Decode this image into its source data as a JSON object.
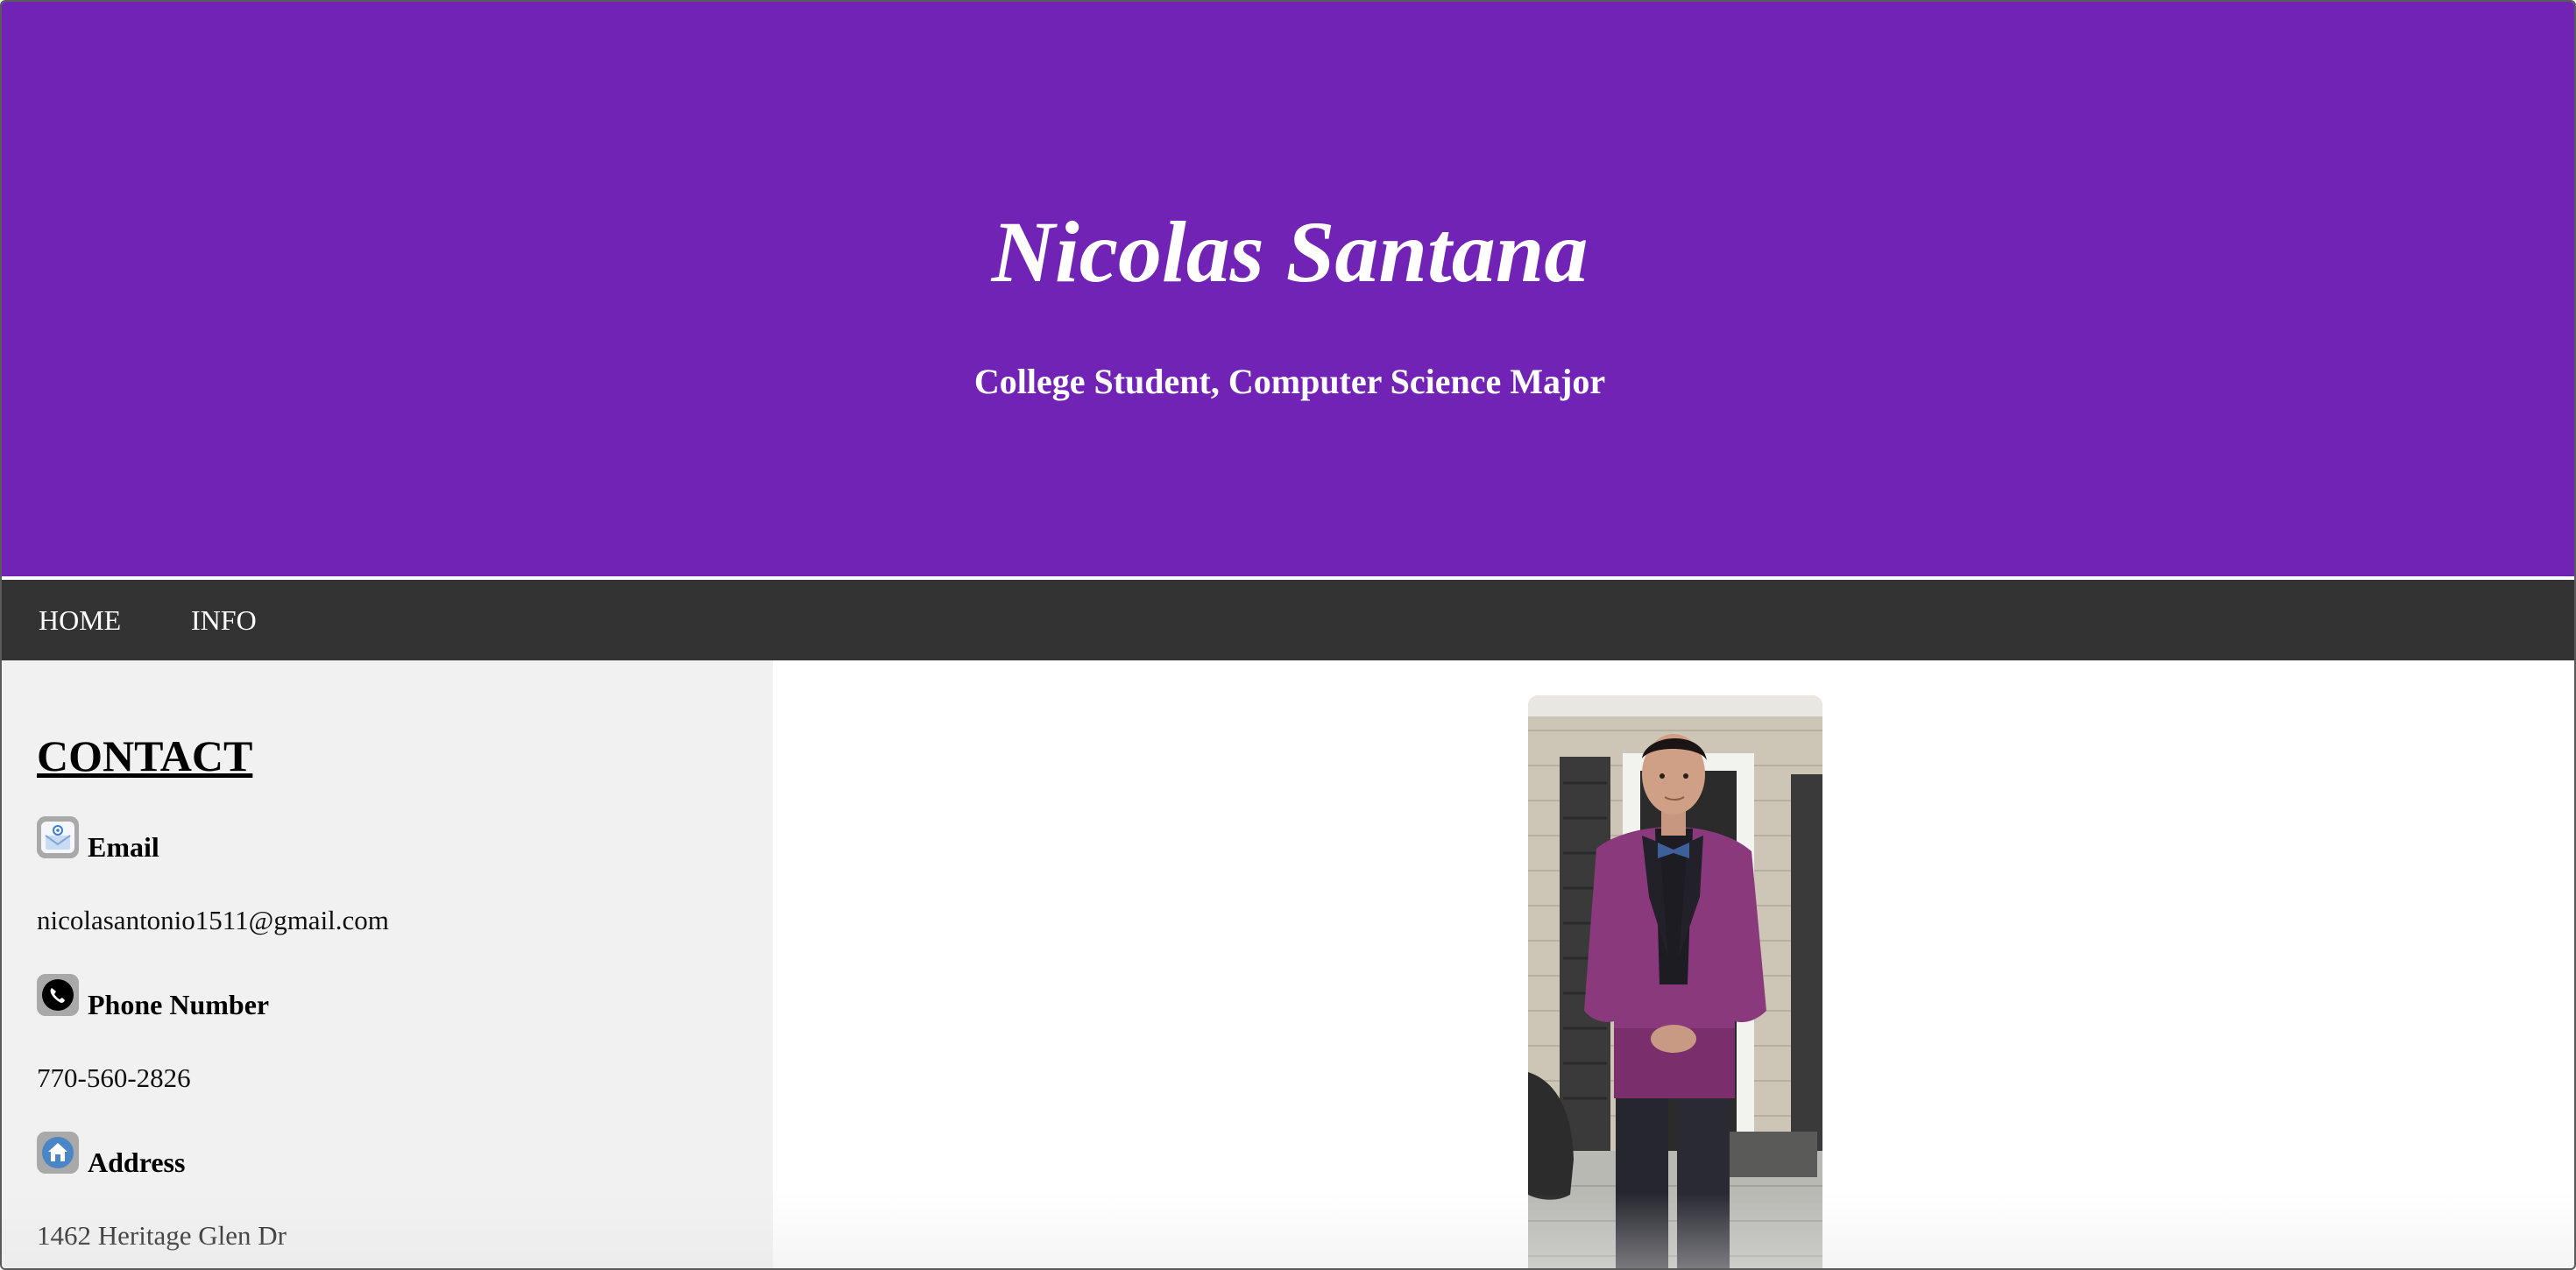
{
  "header": {
    "name": "Nicolas Santana",
    "tagline": "College Student, Computer Science Major",
    "background_color": "#7123b6"
  },
  "nav": {
    "items": [
      {
        "label": "HOME"
      },
      {
        "label": "INFO"
      }
    ],
    "background_color": "#333333"
  },
  "contact": {
    "heading": "CONTACT",
    "items": [
      {
        "icon": "email-icon",
        "label": "Email",
        "value": "nicolasantonio1511@gmail.com"
      },
      {
        "icon": "phone-icon",
        "label": "Phone Number",
        "value": "770-560-2826"
      },
      {
        "icon": "home-icon",
        "label": "Address",
        "value": "1462 Heritage Glen Dr"
      }
    ]
  },
  "main": {
    "photo": {
      "alt": "Portrait photo"
    }
  }
}
